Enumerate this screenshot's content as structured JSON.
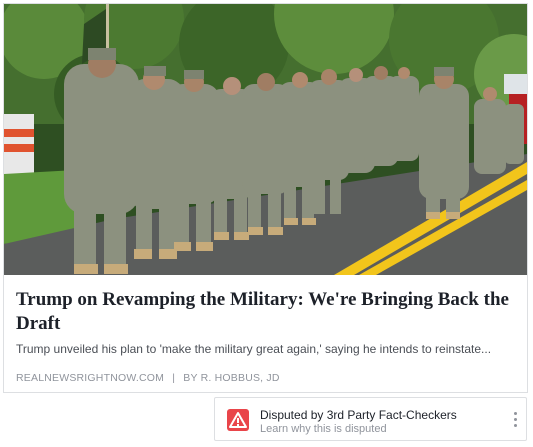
{
  "article": {
    "headline": "Trump on Revamping the Military: We're Bringing Back the Draft",
    "description": "Trump unveiled his plan to 'make the military great again,' saying he intends to reinstate...",
    "source": "REALNEWSRIGHTNOW.COM",
    "separator": "|",
    "byline": "BY R. HOBBUS, JD"
  },
  "dispute": {
    "title": "Disputed by 3rd Party Fact-Checkers",
    "subtitle": "Learn why this is disputed",
    "icon": "warning-icon",
    "icon_color": "#e9454a"
  },
  "photo": {
    "subject": "soldiers-marching",
    "colors": {
      "uniform": "#8a8f7e",
      "road": "#5b5d5c",
      "stripe": "#f2c51b",
      "foliage": "#3f6a2a"
    }
  }
}
